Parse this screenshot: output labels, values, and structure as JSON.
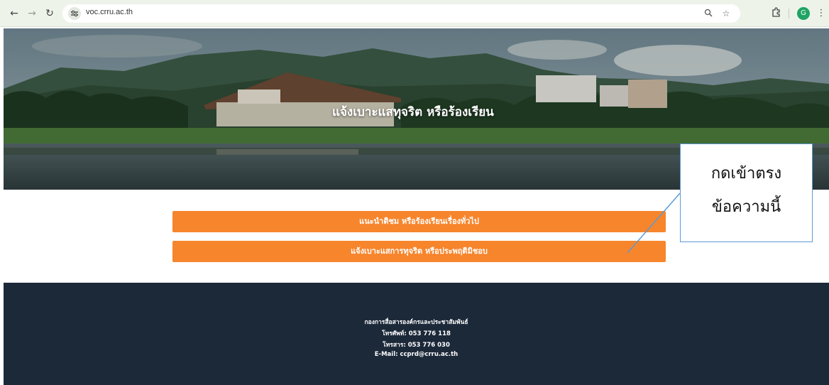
{
  "browser": {
    "url": "voc.crru.ac.th",
    "profile_initial": "G"
  },
  "hero": {
    "title": "แจ้งเบาะแสทุจริต หรือร้องเรียน"
  },
  "buttons": {
    "general": "แนะนำติชม หรือร้องเรียนเรื่องทั่วไป",
    "corruption": "แจ้งเบาะแสการทุจริต หรือประพฤติมิชอบ"
  },
  "callout": {
    "line1": "กดเข้าตรง",
    "line2": "ข้อความนี้"
  },
  "footer": {
    "org": "กองการสื่อสารองค์กรและประชาสัมพันธ์",
    "phone": "โทรศัพท์: 053 776 118",
    "fax": "โทรสาร: 053 776 030",
    "email": "E-Mail: ccprd@crru.ac.th"
  },
  "colors": {
    "button": "#f7852c",
    "footer": "#1c2939",
    "callout_border": "#5b9bd5"
  }
}
